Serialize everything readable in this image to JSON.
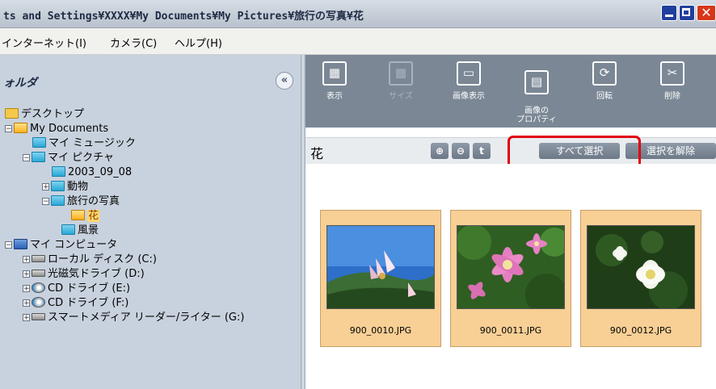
{
  "window": {
    "title": "ts and Settings¥XXXX¥My Documents¥My Pictures¥旅行の写真¥花",
    "close_glyph": "✕"
  },
  "menu": [
    "インターネット(I)",
    "カメラ(C)",
    "ヘルプ(H)"
  ],
  "folder_pane": {
    "title": "ォルダ",
    "collapse_glyph": "«",
    "tree": [
      {
        "label": "デスクトップ",
        "icon": "desktop-icon"
      },
      {
        "label": "My Documents",
        "icon": "folder-open-icon"
      },
      {
        "label": "マイ ミュージック",
        "icon": "folder-icon"
      },
      {
        "label": "マイ ピクチャ",
        "icon": "folder-icon"
      },
      {
        "label": "2003_09_08",
        "icon": "folder-icon"
      },
      {
        "label": "動物",
        "icon": "folder-icon"
      },
      {
        "label": "旅行の写真",
        "icon": "folder-icon"
      },
      {
        "label": "花",
        "icon": "folder-open-icon",
        "selected": true
      },
      {
        "label": "風景",
        "icon": "folder-icon"
      },
      {
        "label": "マイ コンピュータ",
        "icon": "computer-icon"
      },
      {
        "label": "ローカル ディスク (C:)",
        "icon": "drive-icon"
      },
      {
        "label": "光磁気ドライブ (D:)",
        "icon": "drive-icon"
      },
      {
        "label": "CD ドライブ (E:)",
        "icon": "cd-icon"
      },
      {
        "label": "CD ドライブ (F:)",
        "icon": "cd-icon"
      },
      {
        "label": "スマートメディア リーダー/ライター (G:)",
        "icon": "drive-icon"
      }
    ]
  },
  "toolbar": {
    "items": [
      {
        "label": "表示",
        "icon": "view-icon",
        "glyph": "▦"
      },
      {
        "label": "サイズ",
        "icon": "size-icon",
        "glyph": "▦",
        "disabled": true
      },
      {
        "label": "画像表示",
        "icon": "image-view-icon",
        "glyph": "▭"
      },
      {
        "label": "画像の\nプロパティ",
        "icon": "image-properties-icon",
        "glyph": "▤"
      },
      {
        "label": "回転",
        "icon": "rotate-icon",
        "glyph": "⟳"
      },
      {
        "label": "削除",
        "icon": "delete-icon",
        "glyph": "✂"
      }
    ]
  },
  "path_bar": {
    "folder_name": "花",
    "zoom_in": "⊕",
    "zoom_out": "⊖",
    "up": "t",
    "select_all": "すべて選択",
    "deselect": "選択を解除"
  },
  "thumbnails": [
    {
      "filename": "900_0010.JPG"
    },
    {
      "filename": "900_0011.JPG"
    },
    {
      "filename": "900_0012.JPG"
    }
  ],
  "colors": {
    "title_bar": "#c4ccd6",
    "toolbar": "#7b8795",
    "folder_pane": "#c8d2de",
    "thumbnail_bg": "#f8cf95",
    "highlight_box": "#e0000a"
  }
}
